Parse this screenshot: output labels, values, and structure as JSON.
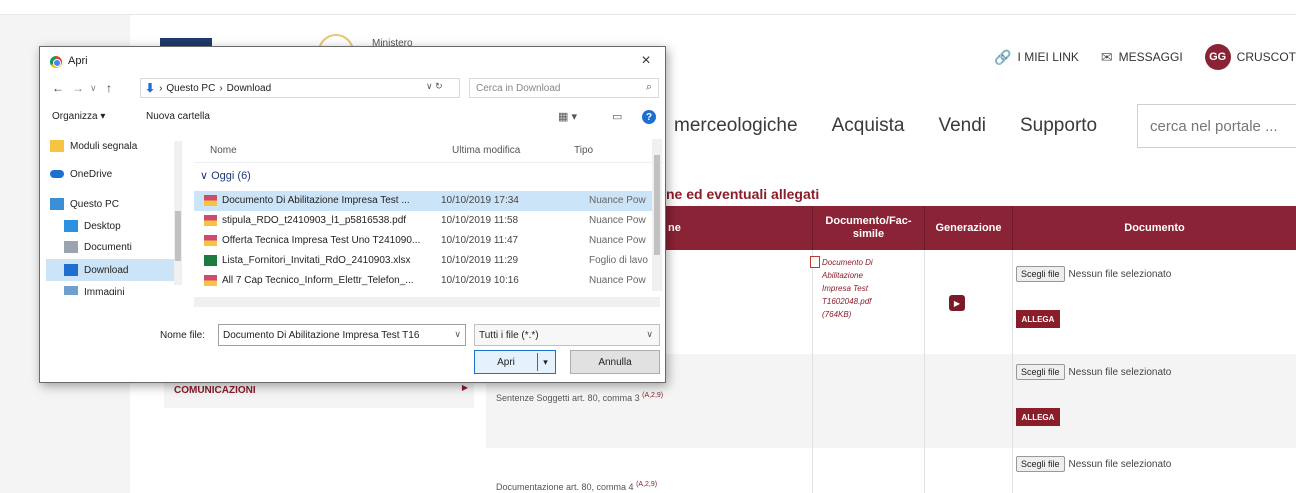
{
  "header": {
    "logo_text": "Ministero",
    "links": [
      {
        "icon": "link-icon",
        "label": "I MIEI LINK"
      },
      {
        "icon": "mail-icon",
        "label": "MESSAGGI"
      }
    ],
    "user_initials": "GG",
    "user_label": "CRUSCOT"
  },
  "nav": {
    "items": [
      "merceologiche",
      "Acquista",
      "Vendi",
      "Supporto"
    ],
    "search_placeholder": "cerca nel portale ..."
  },
  "section": {
    "title": "ne ed eventuali allegati"
  },
  "table": {
    "columns": [
      "ne",
      "Documento/Fac-simile",
      "Generazione",
      "Documento"
    ],
    "rows": [
      {
        "label": "",
        "doc_link": [
          "Documento Di",
          "Abilitazione",
          "Impresa Test",
          "T1602048.pdf",
          "(764KB)"
        ],
        "has_generate": true
      },
      {
        "label": "Sentenze Soggetti art. 80, comma 3",
        "sup": "(A,2,9)"
      },
      {
        "label": "Documentazione art. 80, comma 4",
        "sup": "(A,2,9)"
      }
    ],
    "file_button": "Scegli file",
    "file_status": "Nessun file selezionato",
    "attach_button": "ALLEGA"
  },
  "sidebar": {
    "communications": "COMUNICAZIONI"
  },
  "dialog": {
    "title": "Apri",
    "close": "×",
    "path": [
      "Questo PC",
      "Download"
    ],
    "search_placeholder": "Cerca in Download",
    "toolbar": {
      "organize": "Organizza ▾",
      "new_folder": "Nuova cartella"
    },
    "nav_pane": [
      {
        "label": "Moduli segnala",
        "icon": "folder-icon",
        "color": "#f6c343"
      },
      {
        "label": "OneDrive",
        "icon": "cloud-icon",
        "color": "#1f6fd1"
      },
      {
        "label": "Questo PC",
        "icon": "computer-icon",
        "color": "#3a8fd8"
      },
      {
        "label": "Desktop",
        "icon": "desktop-icon",
        "color": "#2d8fe0"
      },
      {
        "label": "Documenti",
        "icon": "documents-icon",
        "color": "#9aa4b0"
      },
      {
        "label": "Download",
        "icon": "download-icon",
        "color": "#1f6fd1",
        "selected": true
      },
      {
        "label": "Immagini",
        "icon": "images-icon",
        "color": "#6f9fcf"
      }
    ],
    "columns": {
      "name": "Nome",
      "modified": "Ultima modifica",
      "type": "Tipo"
    },
    "group": "Oggi (6)",
    "files": [
      {
        "name": "Documento Di Abilitazione Impresa Test ...",
        "modified": "10/10/2019 17:34",
        "type": "Nuance Pow",
        "icon": "pdf-icon",
        "selected": true
      },
      {
        "name": "stipula_RDO_t2410903_l1_p5816538.pdf",
        "modified": "10/10/2019 11:58",
        "type": "Nuance Pow",
        "icon": "pdf-icon"
      },
      {
        "name": "Offerta Tecnica Impresa Test Uno T241090...",
        "modified": "10/10/2019 11:47",
        "type": "Nuance Pow",
        "icon": "pdf-icon"
      },
      {
        "name": "Lista_Fornitori_Invitati_RdO_2410903.xlsx",
        "modified": "10/10/2019 11:29",
        "type": "Foglio di lavo",
        "icon": "excel-icon"
      },
      {
        "name": "All 7 Cap Tecnico_Inform_Elettr_Telefon_...",
        "modified": "10/10/2019 10:16",
        "type": "Nuance Pow",
        "icon": "pdf-icon"
      }
    ],
    "filename_label": "Nome file:",
    "filename_value": "Documento Di Abilitazione Impresa Test T16",
    "filetype_value": "Tutti i file (*.*)",
    "open_button": "Apri",
    "cancel_button": "Annulla"
  }
}
